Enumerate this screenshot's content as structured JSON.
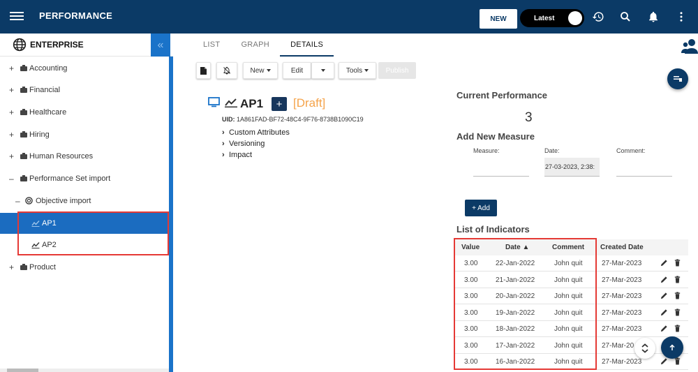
{
  "header": {
    "app_title": "PERFORMANCE",
    "new_label": "NEW",
    "toggle_label": "Latest"
  },
  "sidebar": {
    "title": "ENTERPRISE",
    "collapse_glyph": "«",
    "items": [
      {
        "expander": "+",
        "label": "Accounting"
      },
      {
        "expander": "+",
        "label": "Financial"
      },
      {
        "expander": "+",
        "label": "Healthcare"
      },
      {
        "expander": "+",
        "label": "Hiring"
      },
      {
        "expander": "+",
        "label": "Human Resources"
      },
      {
        "expander": "–",
        "label": "Performance Set import"
      },
      {
        "expander": "–",
        "label": "Objective import"
      },
      {
        "label": "AP1"
      },
      {
        "label": "AP2"
      },
      {
        "expander": "+",
        "label": "Product"
      }
    ]
  },
  "tabs": [
    {
      "label": "LIST"
    },
    {
      "label": "GRAPH"
    },
    {
      "label": "DETAILS"
    }
  ],
  "toolbar": {
    "new_label": "New",
    "edit_label": "Edit",
    "tools_label": "Tools",
    "publish_label": "Publish"
  },
  "detail": {
    "title": "AP1",
    "plus": "+",
    "status": "[Draft]",
    "uid_label": "UID:",
    "uid_value": "1A861FAD-BF72-48C4-9F76-8738B1090C19",
    "sections": [
      "Custom Attributes",
      "Versioning",
      "Impact"
    ]
  },
  "performance": {
    "current_title": "Current Performance",
    "current_value": "3",
    "add_title": "Add New Measure",
    "measure_label": "Measure:",
    "date_label": "Date:",
    "date_value": "27-03-2023, 2:38:",
    "comment_label": "Comment:",
    "add_button": "+ Add"
  },
  "indicators": {
    "title": "List of Indicators",
    "columns": [
      "Value",
      "Date ▲",
      "Comment",
      "Created Date"
    ],
    "rows": [
      {
        "value": "3.00",
        "date": "22-Jan-2022",
        "comment": "John quit",
        "created": "27-Mar-2023"
      },
      {
        "value": "3.00",
        "date": "21-Jan-2022",
        "comment": "John quit",
        "created": "27-Mar-2023"
      },
      {
        "value": "3.00",
        "date": "20-Jan-2022",
        "comment": "John quit",
        "created": "27-Mar-2023"
      },
      {
        "value": "3.00",
        "date": "19-Jan-2022",
        "comment": "John quit",
        "created": "27-Mar-2023"
      },
      {
        "value": "3.00",
        "date": "18-Jan-2022",
        "comment": "John quit",
        "created": "27-Mar-2023"
      },
      {
        "value": "3.00",
        "date": "17-Jan-2022",
        "comment": "John quit",
        "created": "27-Mar-20"
      },
      {
        "value": "3.00",
        "date": "16-Jan-2022",
        "comment": "John quit",
        "created": "27-Mar-2023"
      }
    ]
  },
  "colors": {
    "primary": "#0b3a66",
    "accent": "#1a73c9",
    "draft": "#f5a34a",
    "highlight_border": "#e53935"
  },
  "icons": [
    "menu-icon",
    "history-icon",
    "search-icon",
    "bell-icon",
    "more-vert-icon",
    "globe-icon",
    "briefcase-icon",
    "target-icon",
    "trend-icon",
    "document-icon",
    "notifications-off-icon",
    "user-group-icon",
    "monitor-icon",
    "pencil-icon",
    "trash-icon",
    "arrow-up-icon"
  ]
}
